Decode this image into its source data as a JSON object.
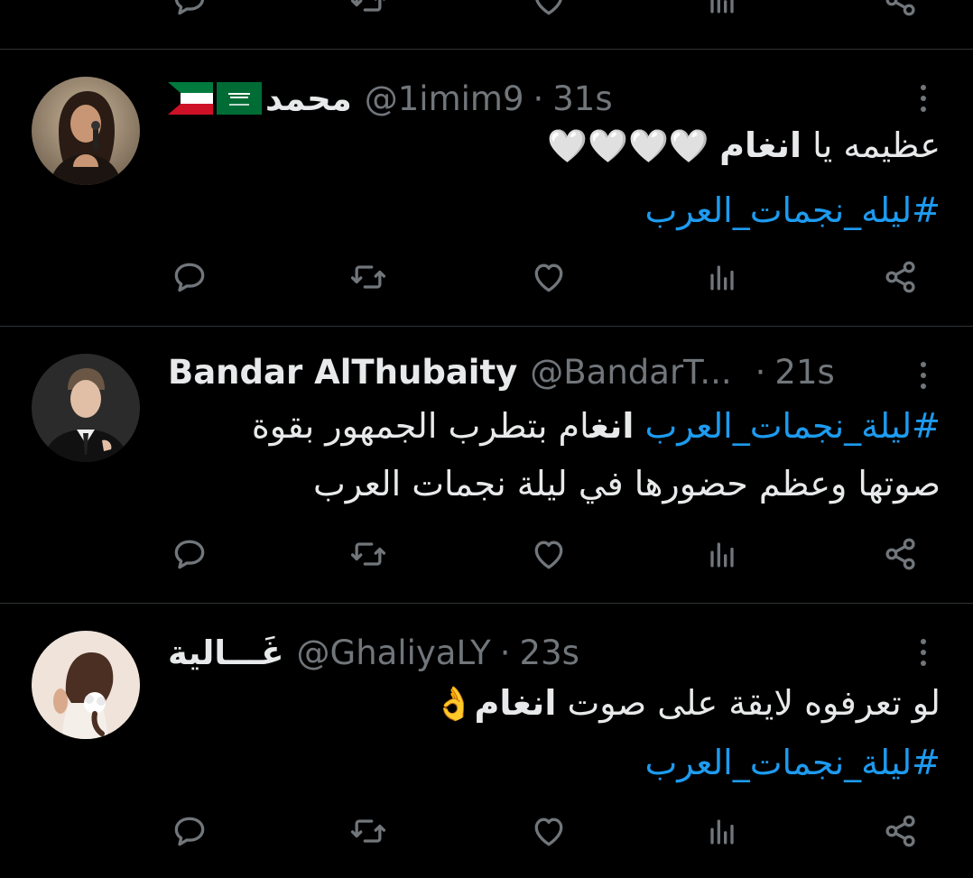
{
  "colors": {
    "background": "#000000",
    "text": "#e7e9ea",
    "secondary": "#71767b",
    "link": "#1d9bf0",
    "divider": "#2f3336"
  },
  "action_icons": [
    "reply-icon",
    "retweet-icon",
    "like-icon",
    "views-icon",
    "share-icon"
  ],
  "tweets": [
    {
      "name": "محمد",
      "flags": [
        "kuwait-flag",
        "saudi-flag"
      ],
      "handle": "@1imim9",
      "separator": "·",
      "time": "31s",
      "text_parts": {
        "pre": "عظيمه يا ",
        "bold": "انغام",
        "post": " 🤍🤍🤍🤍"
      },
      "hashtag": "#ليله_نجمات_العرب"
    },
    {
      "name": "Bandar AlThubaity",
      "handle": "@BandarT...",
      "separator": "·",
      "time": "21s",
      "text_parts": {
        "hashtag": "#ليلة_نجمات_العرب",
        "bold": "انغ",
        "post": "ام بتطرب الجمهور بقوة",
        "line2": "صوتها وعظم حضورها في ليلة نجمات العرب"
      }
    },
    {
      "name": "غَـــالية",
      "handle": "@GhaliyaLY",
      "separator": "·",
      "time": "23s",
      "text_parts": {
        "pre": "لو تعرفوه لايقة على صوت ",
        "bold": "انغام",
        "post": "👌"
      },
      "hashtag": "#ليلة_نجمات_العرب"
    }
  ]
}
